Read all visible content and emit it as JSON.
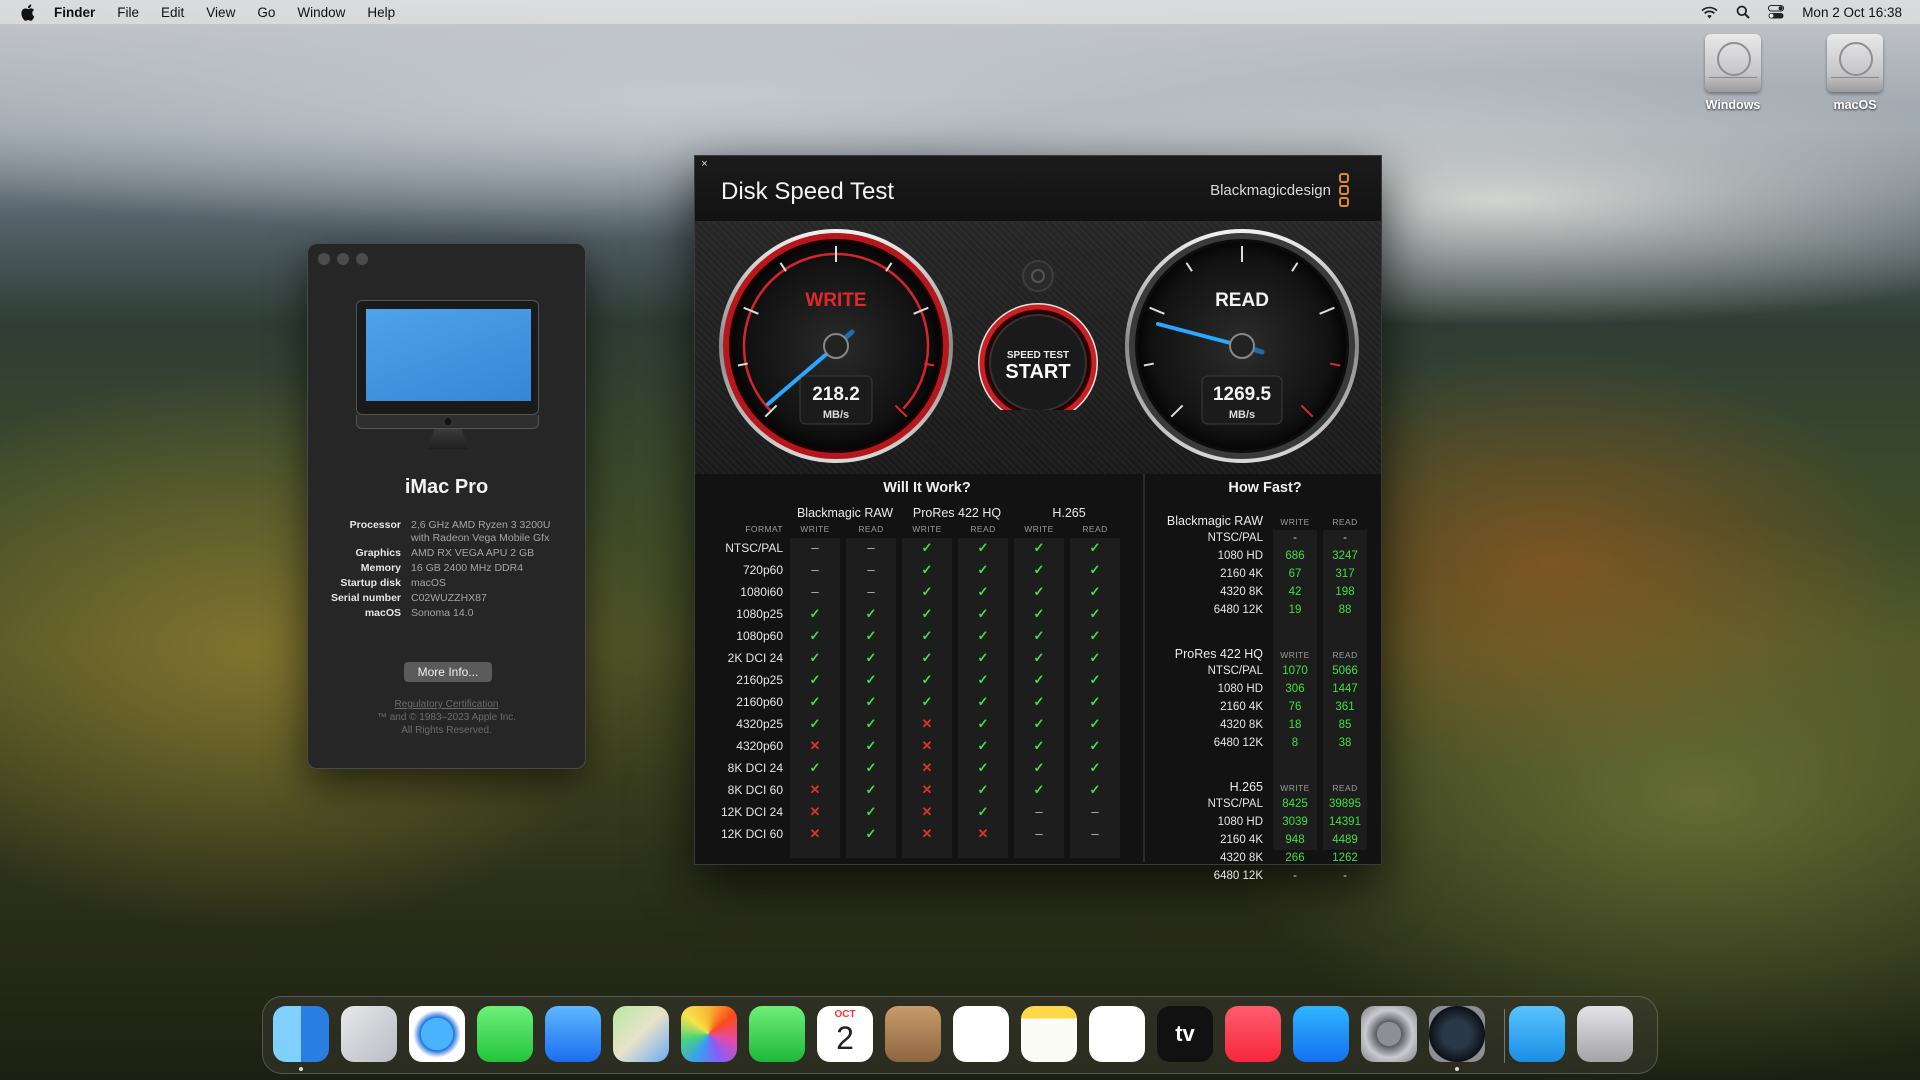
{
  "menubar": {
    "app": "Finder",
    "items": [
      "File",
      "Edit",
      "View",
      "Go",
      "Window",
      "Help"
    ],
    "clock": "Mon 2 Oct  16:38"
  },
  "desktop": {
    "drives": [
      "Windows",
      "macOS"
    ]
  },
  "about": {
    "model": "iMac Pro",
    "specs": [
      {
        "k": "Processor",
        "v": "2,6 GHz AMD Ryzen 3 3200U with Radeon Vega Mobile Gfx"
      },
      {
        "k": "Graphics",
        "v": "AMD RX VEGA APU 2 GB"
      },
      {
        "k": "Memory",
        "v": "16 GB 2400 MHz DDR4"
      },
      {
        "k": "Startup disk",
        "v": "macOS"
      },
      {
        "k": "Serial number",
        "v": "C02WUZZHX87"
      },
      {
        "k": "macOS",
        "v": "Sonoma 14.0"
      }
    ],
    "more_button": "More Info...",
    "legal_link": "Regulatory Certification",
    "legal_1": "™ and © 1983–2023 Apple Inc.",
    "legal_2": "All Rights Reserved."
  },
  "disk_speed": {
    "title": "Disk Speed Test",
    "brand": "Blackmagicdesign",
    "write": {
      "label": "WRITE",
      "value": "218.2",
      "unit": "MB/s"
    },
    "read": {
      "label": "READ",
      "value": "1269.5",
      "unit": "MB/s"
    },
    "start_small": "SPEED TEST",
    "start_big": "START",
    "will_it_work": {
      "title": "Will It Work?",
      "format_label": "FORMAT",
      "groups": [
        "Blackmagic RAW",
        "ProRes 422 HQ",
        "H.265"
      ],
      "write_label": "WRITE",
      "read_label": "READ",
      "rows": [
        {
          "fmt": "NTSC/PAL",
          "v": [
            "-",
            "-",
            "ok",
            "ok",
            "ok",
            "ok"
          ]
        },
        {
          "fmt": "720p60",
          "v": [
            "-",
            "-",
            "ok",
            "ok",
            "ok",
            "ok"
          ]
        },
        {
          "fmt": "1080i60",
          "v": [
            "-",
            "-",
            "ok",
            "ok",
            "ok",
            "ok"
          ]
        },
        {
          "fmt": "1080p25",
          "v": [
            "ok",
            "ok",
            "ok",
            "ok",
            "ok",
            "ok"
          ]
        },
        {
          "fmt": "1080p60",
          "v": [
            "ok",
            "ok",
            "ok",
            "ok",
            "ok",
            "ok"
          ]
        },
        {
          "fmt": "2K DCI 24",
          "v": [
            "ok",
            "ok",
            "ok",
            "ok",
            "ok",
            "ok"
          ]
        },
        {
          "fmt": "2160p25",
          "v": [
            "ok",
            "ok",
            "ok",
            "ok",
            "ok",
            "ok"
          ]
        },
        {
          "fmt": "2160p60",
          "v": [
            "ok",
            "ok",
            "ok",
            "ok",
            "ok",
            "ok"
          ]
        },
        {
          "fmt": "4320p25",
          "v": [
            "ok",
            "ok",
            "no",
            "ok",
            "ok",
            "ok"
          ]
        },
        {
          "fmt": "4320p60",
          "v": [
            "no",
            "ok",
            "no",
            "ok",
            "ok",
            "ok"
          ]
        },
        {
          "fmt": "8K DCI 24",
          "v": [
            "ok",
            "ok",
            "no",
            "ok",
            "ok",
            "ok"
          ]
        },
        {
          "fmt": "8K DCI 60",
          "v": [
            "no",
            "ok",
            "no",
            "ok",
            "ok",
            "ok"
          ]
        },
        {
          "fmt": "12K DCI 24",
          "v": [
            "no",
            "ok",
            "no",
            "ok",
            "-",
            "-"
          ]
        },
        {
          "fmt": "12K DCI 60",
          "v": [
            "no",
            "ok",
            "no",
            "no",
            "-",
            "-"
          ]
        }
      ]
    },
    "how_fast": {
      "title": "How Fast?",
      "write_label": "WRITE",
      "read_label": "READ",
      "groups": [
        {
          "name": "Blackmagic RAW",
          "rows": [
            {
              "fmt": "NTSC/PAL",
              "w": "-",
              "r": "-"
            },
            {
              "fmt": "1080 HD",
              "w": "686",
              "r": "3247"
            },
            {
              "fmt": "2160 4K",
              "w": "67",
              "r": "317"
            },
            {
              "fmt": "4320 8K",
              "w": "42",
              "r": "198"
            },
            {
              "fmt": "6480 12K",
              "w": "19",
              "r": "88"
            }
          ]
        },
        {
          "name": "ProRes 422 HQ",
          "rows": [
            {
              "fmt": "NTSC/PAL",
              "w": "1070",
              "r": "5066"
            },
            {
              "fmt": "1080 HD",
              "w": "306",
              "r": "1447"
            },
            {
              "fmt": "2160 4K",
              "w": "76",
              "r": "361"
            },
            {
              "fmt": "4320 8K",
              "w": "18",
              "r": "85"
            },
            {
              "fmt": "6480 12K",
              "w": "8",
              "r": "38"
            }
          ]
        },
        {
          "name": "H.265",
          "rows": [
            {
              "fmt": "NTSC/PAL",
              "w": "8425",
              "r": "39895"
            },
            {
              "fmt": "1080 HD",
              "w": "3039",
              "r": "14391"
            },
            {
              "fmt": "2160 4K",
              "w": "948",
              "r": "4489"
            },
            {
              "fmt": "4320 8K",
              "w": "266",
              "r": "1262"
            },
            {
              "fmt": "6480 12K",
              "w": "-",
              "r": "-"
            }
          ]
        }
      ]
    }
  },
  "dock": {
    "apps": [
      "finder-icon",
      "launchpad-icon",
      "safari-icon",
      "messages-icon",
      "mail-icon",
      "maps-icon",
      "photos-icon",
      "facetime-icon",
      "calendar-icon",
      "contacts-icon",
      "reminders-icon",
      "notes-icon",
      "freeform-icon",
      "tv-icon",
      "music-icon",
      "app-store-icon",
      "system-settings-icon",
      "disk-speed-test-icon",
      "downloads-folder-icon",
      "trash-icon"
    ],
    "calendar_month": "OCT",
    "calendar_day": "2",
    "tv_label": "tv"
  },
  "colors": {
    "ok": "#3ee13e",
    "no": "#e0312d",
    "write_red": "#e3262a",
    "needle_blue": "#2aa7ff",
    "brand_orange": "#e18a2b"
  }
}
